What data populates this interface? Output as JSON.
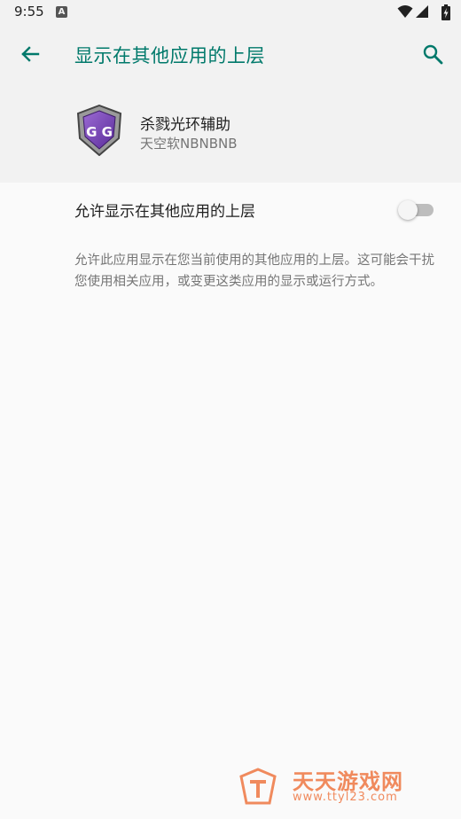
{
  "status_bar": {
    "time": "9:55",
    "notification_icon": "A"
  },
  "app_bar": {
    "title": "显示在其他应用的上层",
    "back_icon": "arrow-back-icon",
    "search_icon": "search-icon",
    "accent_color": "#00796b"
  },
  "app_info": {
    "name": "杀戮光环辅助",
    "vendor": "天空软NBNBNB",
    "icon": "game-guardian-icon",
    "icon_text": "G G"
  },
  "setting": {
    "label": "允许显示在其他应用的上层",
    "enabled": false
  },
  "description": "允许此应用显示在您当前使用的其他应用的上层。这可能会干扰您使用相关应用，或变更这类应用的显示或运行方式。",
  "watermark": {
    "title": "天天游戏网",
    "url": "www.ttyl23.com",
    "color": "#f08a5d"
  }
}
